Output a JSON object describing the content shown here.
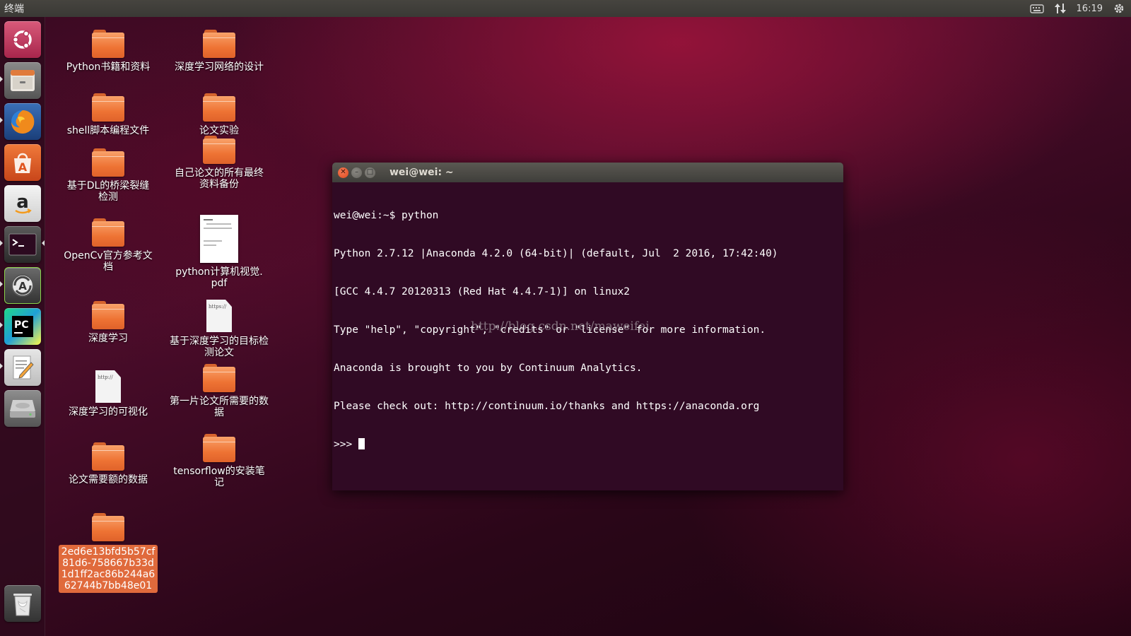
{
  "top_panel": {
    "app_title": "终端",
    "clock": "16:19",
    "icons": [
      "keyboard-icon",
      "network-arrows-icon",
      "gear-power-icon"
    ]
  },
  "launcher": {
    "items": [
      "ubuntu-dash-icon",
      "files-icon",
      "firefox-icon",
      "software-center-icon",
      "amazon-icon",
      "terminal-icon",
      "software-updater-icon",
      "pycharm-icon",
      "text-editor-icon",
      "drive-icon",
      "trash-icon"
    ]
  },
  "desktop": {
    "items": [
      {
        "label": "Python书籍和资料",
        "type": "folder"
      },
      {
        "label": "shell脚本编程文件",
        "type": "folder"
      },
      {
        "label": "基于DL的桥梁裂缝检测",
        "type": "folder"
      },
      {
        "label": "OpenCv官方参考文档",
        "type": "folder"
      },
      {
        "label": "深度学习",
        "type": "folder"
      },
      {
        "label": "深度学习的可视化",
        "type": "link"
      },
      {
        "label": "论文需要额的数据",
        "type": "folder"
      },
      {
        "label": "2ed6e13bfd5b57cf81d6-758667b33d1d1ff2ac86b244a662744b7bb48e01",
        "type": "folder"
      },
      {
        "label": "深度学习网络的设计",
        "type": "folder"
      },
      {
        "label": "论文实验",
        "type": "folder"
      },
      {
        "label": "自己论文的所有最终资料备份",
        "type": "folder"
      },
      {
        "label": "python计算机视觉.pdf",
        "type": "pdf"
      },
      {
        "label": "基于深度学习的目标检测论文",
        "type": "link"
      },
      {
        "label": "第一片论文所需要的数据",
        "type": "folder"
      },
      {
        "label": "tensorflow的安装笔记",
        "type": "folder"
      }
    ],
    "link_thumb_1": "https://",
    "link_thumb_2": "http://"
  },
  "terminal": {
    "title": "wei@wei: ~",
    "lines": [
      "wei@wei:~$ python",
      "Python 2.7.12 |Anaconda 4.2.0 (64-bit)| (default, Jul  2 2016, 17:42:40)",
      "[GCC 4.4.7 20120313 (Red Hat 4.4.7-1)] on linux2",
      "Type \"help\", \"copyright\", \"credits\" or \"license\" for more information.",
      "Anaconda is brought to you by Continuum Analytics.",
      "Please check out: http://continuum.io/thanks and https://anaconda.org"
    ],
    "prompt": ">>> ",
    "close_glyph": "✕",
    "min_glyph": "–",
    "max_glyph": "□"
  },
  "watermark": "http://blog.csdn.net/maweifei"
}
